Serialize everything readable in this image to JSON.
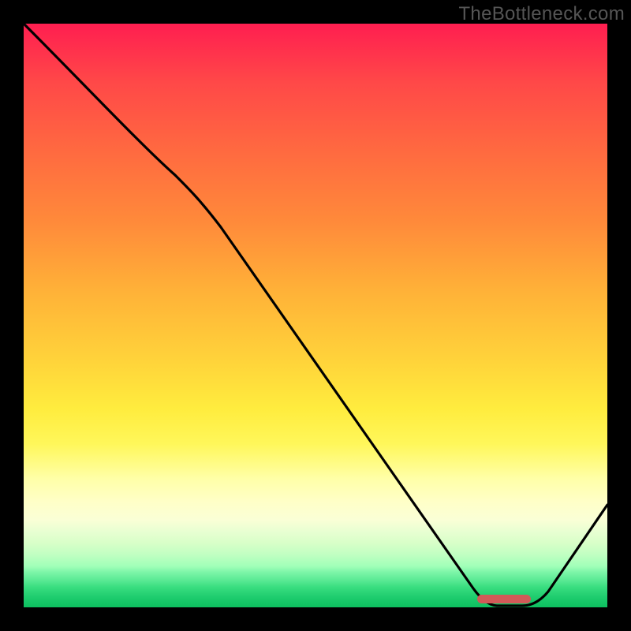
{
  "watermark": "TheBottleneck.com",
  "chart_data": {
    "type": "line",
    "x": [
      0,
      0.26,
      0.8,
      0.86,
      1.0
    ],
    "values": [
      1.0,
      0.74,
      0.0,
      0.0,
      0.18
    ],
    "marker": {
      "x_start": 0.78,
      "x_end": 0.88,
      "y": 0.004
    },
    "xlim": [
      0,
      1
    ],
    "ylim": [
      0,
      1
    ],
    "xlabel": "",
    "ylabel": "",
    "title": "",
    "background": "heat-gradient",
    "gradient_stops": [
      {
        "pos": 0.0,
        "color": "#ff1e50"
      },
      {
        "pos": 0.5,
        "color": "#ffd43a"
      },
      {
        "pos": 0.83,
        "color": "#ffffc8"
      },
      {
        "pos": 1.0,
        "color": "#0dc060"
      }
    ]
  }
}
